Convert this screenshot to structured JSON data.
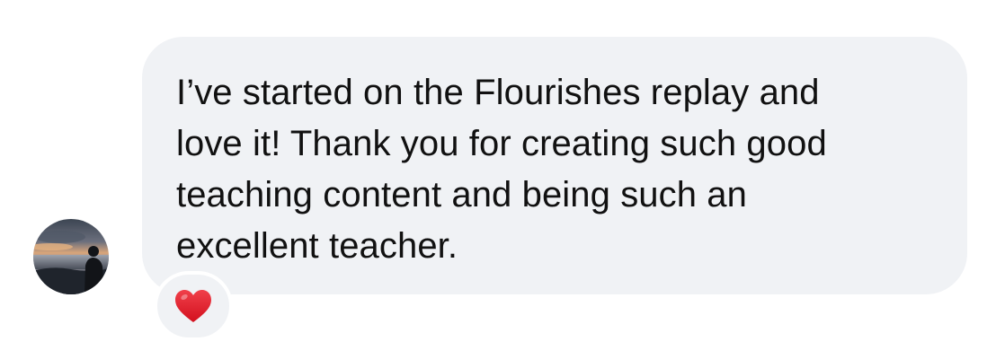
{
  "message": {
    "text": "I’ve started on the Flourishes replay and\nlove it! Thank you for creating such good\nteaching content and being such an\nexcellent teacher.",
    "bubble_color": "#f0f2f5",
    "text_color": "#111111"
  },
  "avatar": {
    "icon": "profile-photo-sunset-silhouette"
  },
  "reaction": {
    "icon": "red-heart-icon",
    "color": "#e8202e"
  }
}
